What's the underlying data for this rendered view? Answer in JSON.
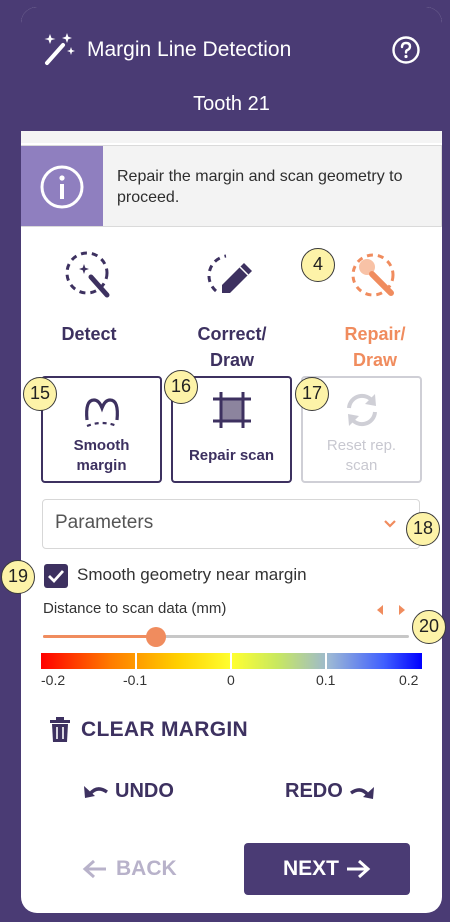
{
  "header": {
    "title": "Margin Line Detection",
    "subtitle": "Tooth 21",
    "icons": {
      "title": "magic-wand-icon",
      "help": "help-circle-icon"
    }
  },
  "info": {
    "message": "Repair the margin and scan geometry to proceed.",
    "icon": "info-icon"
  },
  "modes": [
    {
      "label_1": "Detect",
      "label_2": "",
      "active": false,
      "icon": "detect-wand-icon"
    },
    {
      "label_1": "Correct/",
      "label_2": "Draw",
      "active": false,
      "icon": "pencil-icon"
    },
    {
      "label_1": "Repair/",
      "label_2": "Draw",
      "active": true,
      "icon": "repair-brush-icon"
    }
  ],
  "tools": [
    {
      "label_1": "Smooth",
      "label_2": "margin",
      "enabled": true,
      "icon": "smooth-margin-icon"
    },
    {
      "label_1": "Repair scan",
      "label_2": "",
      "enabled": true,
      "icon": "repair-scan-icon"
    },
    {
      "label_1": "Reset rep.",
      "label_2": "scan",
      "enabled": false,
      "icon": "reset-icon"
    }
  ],
  "callouts": [
    "4",
    "15",
    "16",
    "17",
    "18",
    "19",
    "20"
  ],
  "parameters": {
    "label": "Parameters"
  },
  "smooth_geometry": {
    "label": "Smooth geometry near margin",
    "checked": true
  },
  "distance": {
    "label": "Distance to scan data (mm)",
    "value_fraction": 0.31,
    "colorbar_labels": [
      "-0.2",
      "-0.1",
      "0",
      "0.1",
      "0.2"
    ]
  },
  "actions": {
    "clear_margin": "CLEAR MARGIN",
    "undo": "UNDO",
    "redo": "REDO",
    "back": "BACK",
    "next": "NEXT"
  },
  "colors": {
    "primary": "#4a3b74",
    "accent": "#f08c5e",
    "info_icon_bg": "#8f7fbf",
    "callout_fill": "#fdf3a8"
  }
}
